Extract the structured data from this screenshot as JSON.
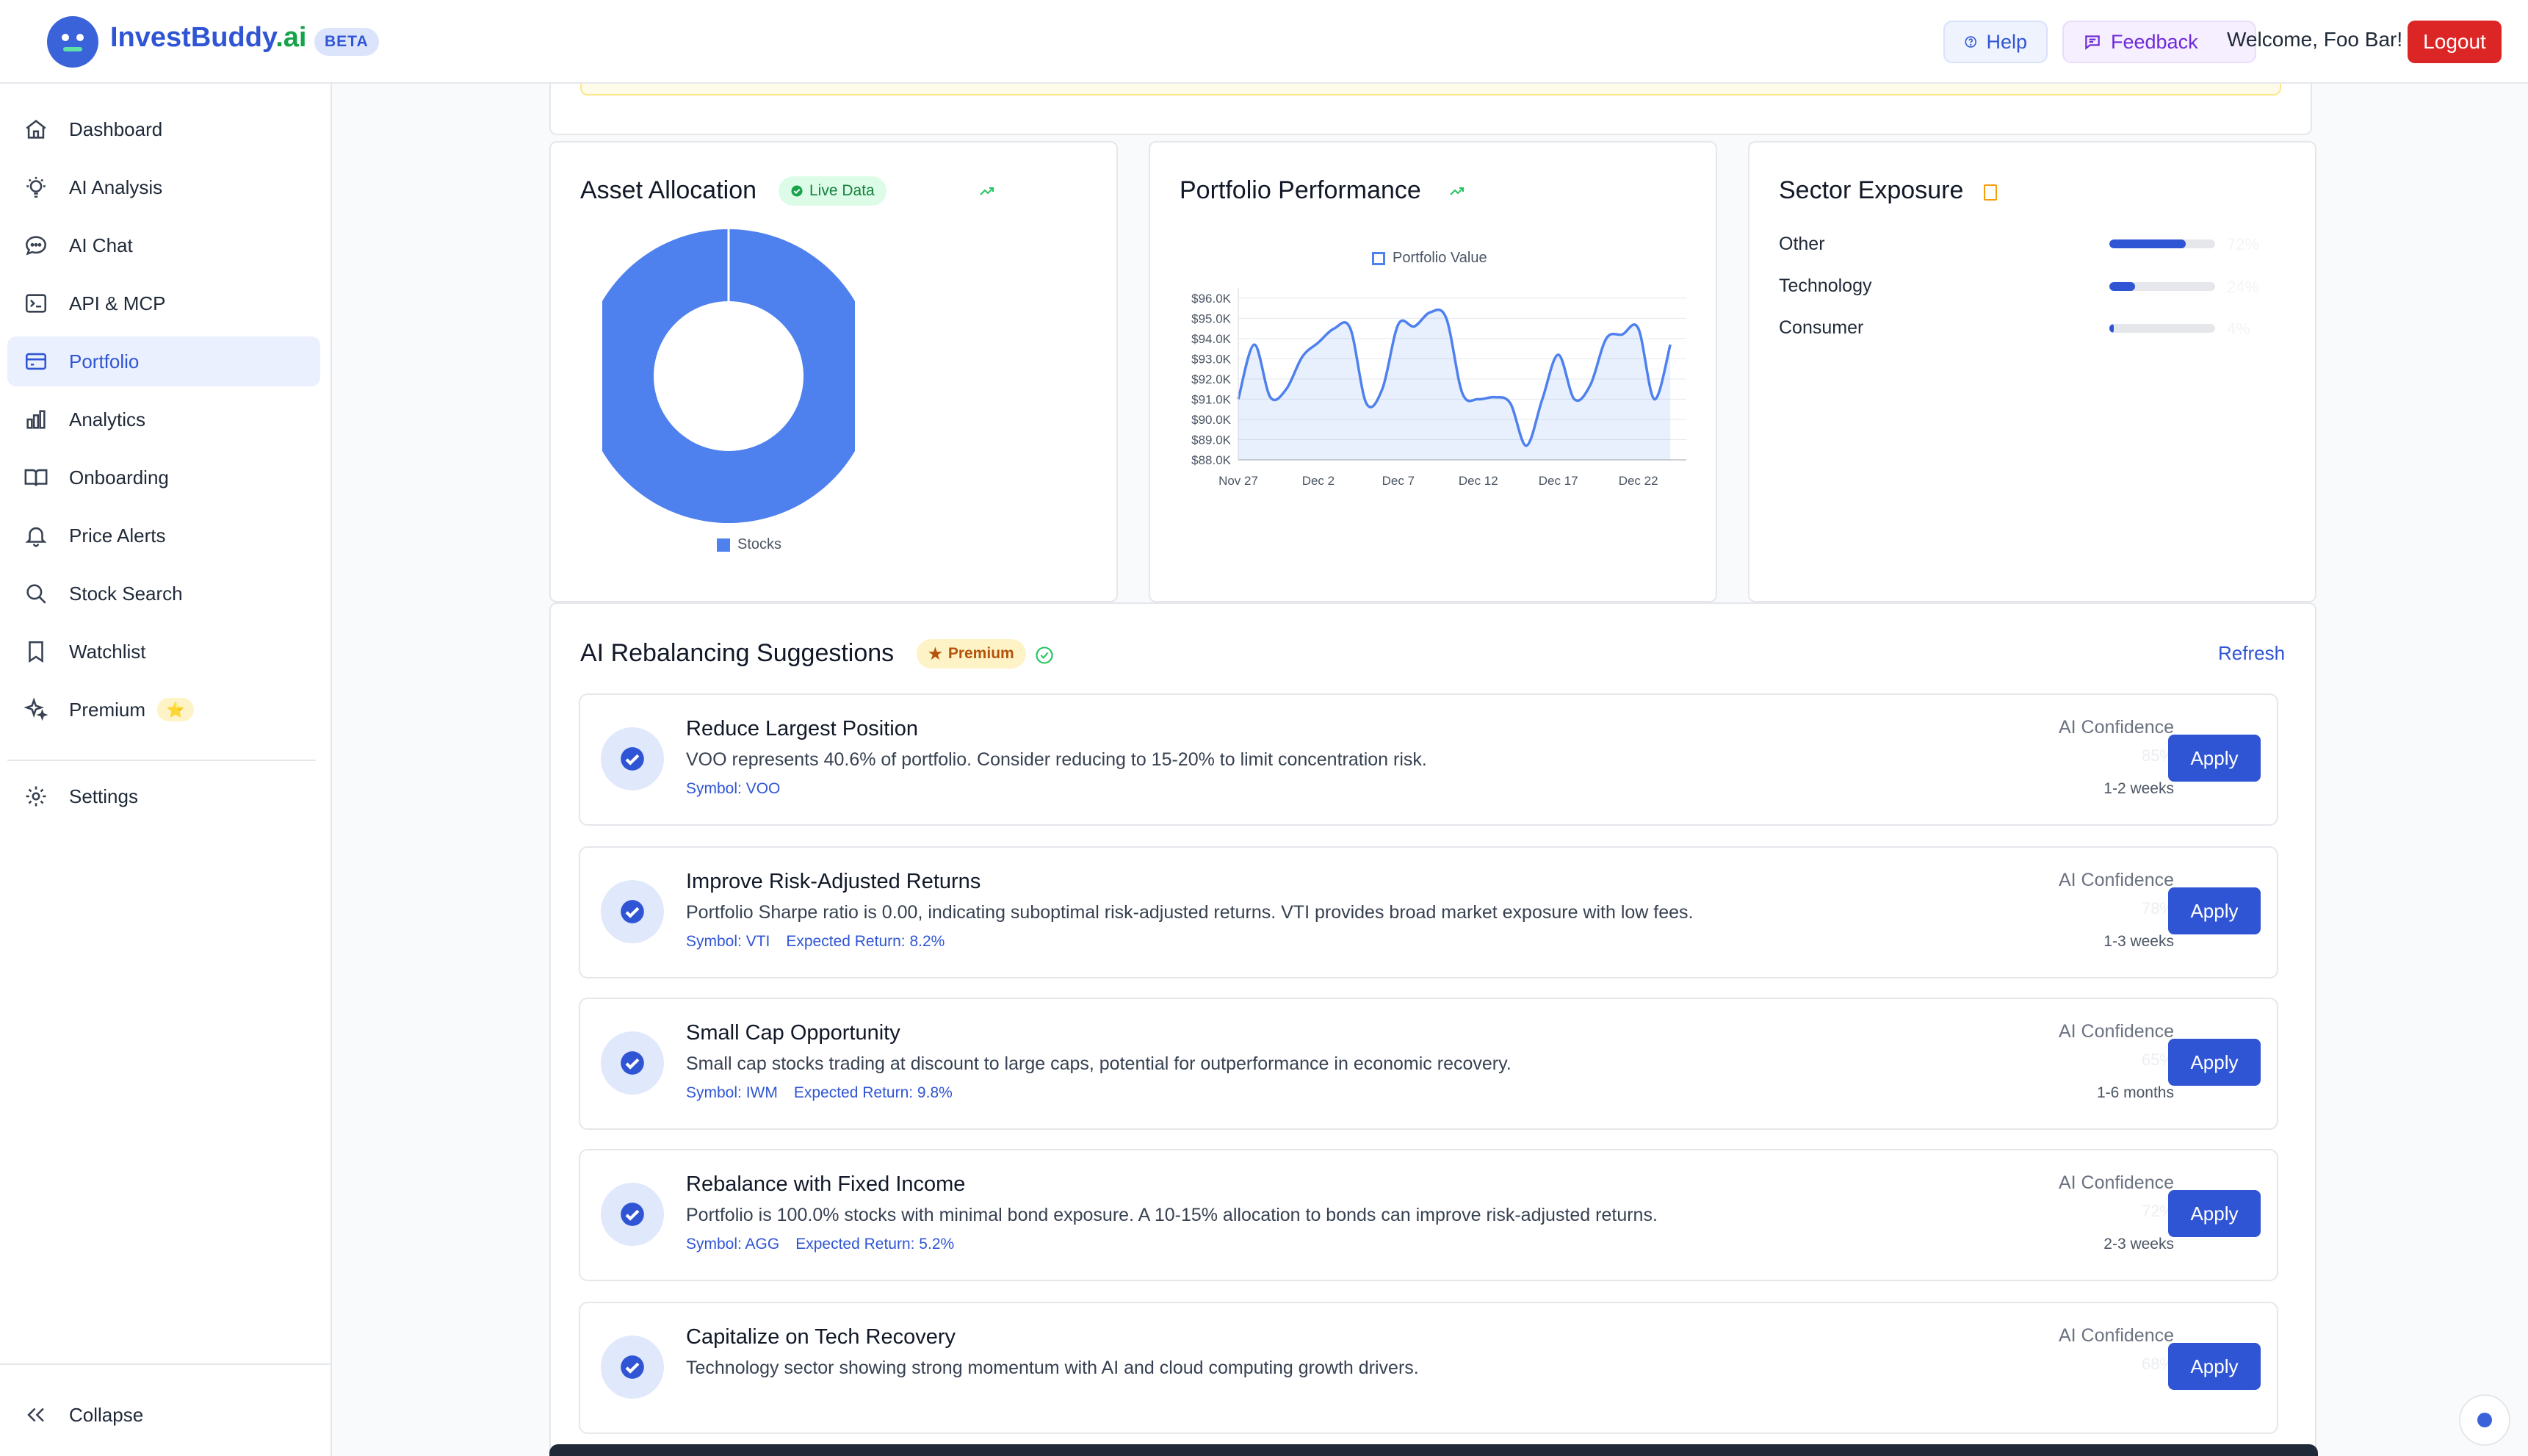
{
  "brand": {
    "name_part1": "InvestBuddy",
    "name_part2": ".ai",
    "badge": "BETA"
  },
  "header": {
    "help_label": "Help",
    "feedback_label": "Feedback",
    "welcome_text": "Welcome, Foo Bar!",
    "logout_label": "Logout"
  },
  "sidebar": {
    "items": [
      {
        "label": "Dashboard",
        "icon": "home-icon"
      },
      {
        "label": "AI Analysis",
        "icon": "lightbulb-icon"
      },
      {
        "label": "AI Chat",
        "icon": "chat-icon"
      },
      {
        "label": "API & MCP",
        "icon": "terminal-icon"
      },
      {
        "label": "Portfolio",
        "icon": "wallet-icon",
        "active": true
      },
      {
        "label": "Analytics",
        "icon": "bar-chart-icon"
      },
      {
        "label": "Onboarding",
        "icon": "book-icon"
      },
      {
        "label": "Price Alerts",
        "icon": "bell-icon"
      },
      {
        "label": "Stock Search",
        "icon": "search-icon"
      },
      {
        "label": "Watchlist",
        "icon": "bookmark-icon"
      },
      {
        "label": "Premium",
        "icon": "sparkles-icon",
        "badge": "⭐"
      }
    ],
    "settings_label": "Settings",
    "collapse_label": "Collapse"
  },
  "asset_allocation": {
    "title": "Asset Allocation",
    "badge": "Live Data",
    "legend": "Stocks"
  },
  "portfolio_performance": {
    "title": "Portfolio Performance",
    "legend": "Portfolio Value"
  },
  "sector_exposure": {
    "title": "Sector Exposure",
    "sectors": [
      {
        "name": "Other",
        "pct_label": "72%",
        "fraction": 0.72
      },
      {
        "name": "Technology",
        "pct_label": "24%",
        "fraction": 0.24
      },
      {
        "name": "Consumer",
        "pct_label": "4%",
        "fraction": 0.04
      }
    ]
  },
  "rebalancing": {
    "title": "AI Rebalancing Suggestions",
    "premium_badge": "Premium",
    "refresh_label": "Refresh",
    "confidence_label": "AI Confidence",
    "apply_label": "Apply",
    "items": [
      {
        "title": "Reduce Largest Position",
        "desc": "VOO represents 40.6% of portfolio. Consider reducing to 15-20% to limit concentration risk.",
        "symbol": "Symbol: VOO",
        "expected": "",
        "confidence": "85%",
        "timeframe": "1-2 weeks"
      },
      {
        "title": "Improve Risk-Adjusted Returns",
        "desc": "Portfolio Sharpe ratio is 0.00, indicating suboptimal risk-adjusted returns. VTI provides broad market exposure with low fees.",
        "symbol": "Symbol: VTI",
        "expected": "Expected Return: 8.2%",
        "confidence": "78%",
        "timeframe": "1-3 weeks"
      },
      {
        "title": "Small Cap Opportunity",
        "desc": "Small cap stocks trading at discount to large caps, potential for outperformance in economic recovery.",
        "symbol": "Symbol: IWM",
        "expected": "Expected Return: 9.8%",
        "confidence": "65%",
        "timeframe": "1-6 months"
      },
      {
        "title": "Rebalance with Fixed Income",
        "desc": "Portfolio is 100.0% stocks with minimal bond exposure. A 10-15% allocation to bonds can improve risk-adjusted returns.",
        "symbol": "Symbol: AGG",
        "expected": "Expected Return: 5.2%",
        "confidence": "72%",
        "timeframe": "2-3 weeks"
      },
      {
        "title": "Capitalize on Tech Recovery",
        "desc": "Technology sector showing strong momentum with AI and cloud computing growth drivers.",
        "symbol": "",
        "expected": "",
        "confidence": "68%",
        "timeframe": ""
      }
    ]
  },
  "colors": {
    "accent": "#2f55d4",
    "chart_blue": "#4e80ee",
    "logout_red": "#dc2626"
  },
  "chart_data": [
    {
      "type": "pie",
      "categories": [
        "Stocks"
      ],
      "values": [
        100
      ],
      "title": "Asset Allocation",
      "legend": "bottom"
    },
    {
      "type": "area",
      "title": "Portfolio Performance",
      "xlabel": "",
      "ylabel": "",
      "x_ticks": [
        "Nov 27",
        "Dec 2",
        "Dec 7",
        "Dec 12",
        "Dec 17",
        "Dec 22"
      ],
      "y_ticks": [
        "$88.0K",
        "$89.0K",
        "$90.0K",
        "$91.0K",
        "$92.0K",
        "$93.0K",
        "$94.0K",
        "$95.0K",
        "$96.0K"
      ],
      "ylim": [
        88000,
        96500
      ],
      "x_days": [
        0,
        1,
        2,
        3,
        4,
        5,
        6,
        7,
        8,
        9,
        10,
        11,
        12,
        13,
        14,
        15,
        16,
        17,
        18,
        19,
        20,
        21,
        22,
        23,
        24,
        25,
        26,
        27,
        28
      ],
      "series": [
        {
          "name": "Portfolio Value",
          "values": [
            91000,
            93700,
            91100,
            91500,
            93100,
            93800,
            94500,
            94500,
            90800,
            91500,
            94700,
            94600,
            95300,
            95000,
            91300,
            91000,
            91100,
            90800,
            88700,
            91000,
            93200,
            91000,
            91700,
            94000,
            94200,
            94500,
            91000,
            93700
          ]
        }
      ],
      "legend": "top",
      "grid": true
    }
  ]
}
